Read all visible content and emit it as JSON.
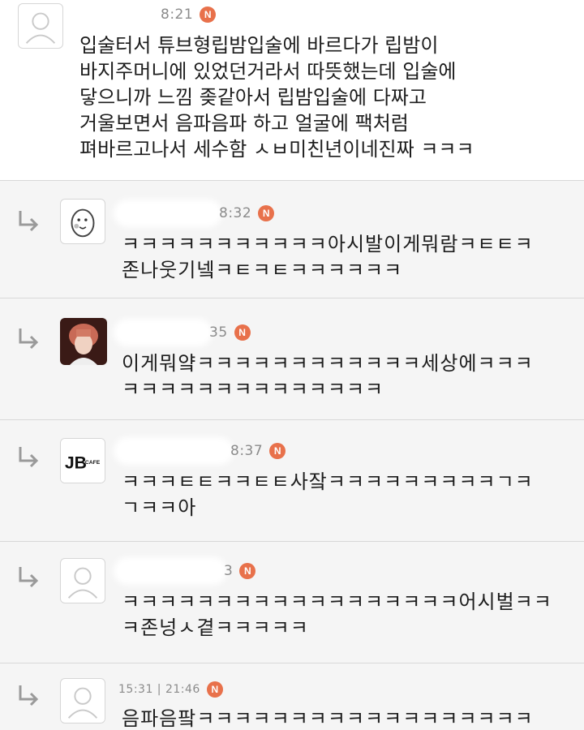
{
  "comments": [
    {
      "time": "8:21",
      "badge": "N",
      "avatar_icon": "default-user-icon",
      "text": "입술터서 튜브형립밤입술에 바르다가 립밤이\n바지주머니에 있었던거라서 따뜻했는데 입술에\n닿으니까 느낌 좆같아서 립밤입술에 다짜고\n거울보면서 음파음파 하고 얼굴에 팩처럼\n펴바르고나서 세수함 ㅅㅂ미친년이네진짜 ㅋㅋㅋ"
    },
    {
      "time": "8:32",
      "badge": "N",
      "avatar_icon": "egg-face-icon",
      "text": "ㅋㅋㅋㅋㅋㅋㅋㅋㅋㅋㅋ아시발이게뭐람ㅋㅌㅌㅋ\n존나웃기넼ㅋㅌㅋㅌㅋㅋㅋㅋㅋㅋ"
    },
    {
      "time": "35",
      "badge": "N",
      "avatar_icon": "person-photo-icon",
      "text": "이게뭐얔ㅋㅋㅋㅋㅋㅋㅋㅋㅋㅋㅋㅋ세상에ㅋㅋㅋ\nㅋㅋㅋㅋㅋㅋㅋㅋㅋㅋㅋㅋㅋㅋ"
    },
    {
      "time": "8:37",
      "badge": "N",
      "avatar_icon": "jb-cafe-logo-icon",
      "avatar_logo_main": "JB",
      "avatar_logo_sub": "CAFE",
      "text": "ㅋㅋㅋㅌㅌㅋㅋㅌㅌ사잨ㅋㅋㅋㅋㅋㅋㅋㅋㅋㄱㅋ\nㄱㅋㅋ아"
    },
    {
      "time": "3",
      "badge": "N",
      "avatar_icon": "default-user-icon",
      "text": "ㅋㅋㅋㅋㅋㅋㅋㅋㅋㅋㅋㅋㅋㅋㅋㅋㅋㅋ어시벌ㅋㅋ\nㅋ존넝ㅅ곁ㅋㅋㅋㅋㅋ"
    },
    {
      "time": "15:31 | 21:46",
      "badge": "N",
      "avatar_icon": "default-user-icon",
      "text": "음파음팤ㅋㅋㅋㅋㅋㅋㅋㅋㅋㅋㅋㅋㅋㅋㅋㅋㅋㅋ"
    }
  ],
  "colors": {
    "badge": "#e8714b",
    "reply_background": "#f5f5f5",
    "divider": "#d8d8d8",
    "timestamp": "#8b8b8b"
  }
}
